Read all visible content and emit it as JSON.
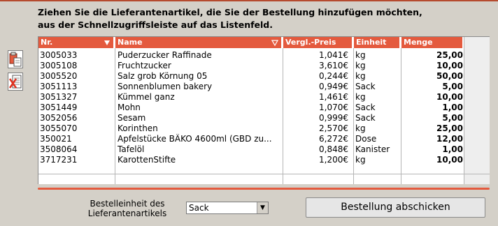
{
  "instruction": {
    "line1": "Ziehen Sie die Lieferantenartikel, die Sie der Bestellung hinzufügen möchten,",
    "line2": "aus der Schnellzugriffsleiste auf das Listenfeld."
  },
  "table": {
    "columns": [
      {
        "key": "nr",
        "label": "Nr."
      },
      {
        "key": "name",
        "label": "Name"
      },
      {
        "key": "preis",
        "label": "Vergl.-Preis"
      },
      {
        "key": "einheit",
        "label": "Einheit"
      },
      {
        "key": "menge",
        "label": "Menge"
      }
    ],
    "rows": [
      {
        "nr": "3005033",
        "name": "Puderzucker Raffinade",
        "preis": "1,041€",
        "einheit": "kg",
        "menge": "25,00"
      },
      {
        "nr": "3005108",
        "name": "Fruchtzucker",
        "preis": "3,610€",
        "einheit": "kg",
        "menge": "10,00"
      },
      {
        "nr": "3005520",
        "name": "Salz grob Körnung 05",
        "preis": "0,244€",
        "einheit": "kg",
        "menge": "50,00"
      },
      {
        "nr": "3051113",
        "name": "Sonnenblumen bakery",
        "preis": "0,949€",
        "einheit": "Sack",
        "menge": "5,00"
      },
      {
        "nr": "3051327",
        "name": "Kümmel ganz",
        "preis": "1,461€",
        "einheit": "kg",
        "menge": "10,00"
      },
      {
        "nr": "3051449",
        "name": "Mohn",
        "preis": "1,070€",
        "einheit": "Sack",
        "menge": "1,00"
      },
      {
        "nr": "3052056",
        "name": "Sesam",
        "preis": "0,999€",
        "einheit": "Sack",
        "menge": "5,00"
      },
      {
        "nr": "3055070",
        "name": "Korinthen",
        "preis": "2,570€",
        "einheit": "kg",
        "menge": "25,00"
      },
      {
        "nr": "350021",
        "name": "Apfelstücke BÄKO 4600ml (GBD zu...",
        "preis": "6,272€",
        "einheit": "Dose",
        "menge": "12,00"
      },
      {
        "nr": "3508064",
        "name": "Tafelöl",
        "preis": "0,848€",
        "einheit": "Kanister",
        "menge": "1,00"
      },
      {
        "nr": "3717231",
        "name": "KarottenStifte",
        "preis": "1,200€",
        "einheit": "kg",
        "menge": "10,00"
      }
    ]
  },
  "footer": {
    "unit_label_line1": "Bestelleinheit des",
    "unit_label_line2": "Lieferantenartikels",
    "unit_selected": "Sack",
    "submit_label": "Bestellung abschicken"
  },
  "colors": {
    "accent": "#e45a3e",
    "background": "#d4d0c8"
  },
  "icons": {
    "paste": "paste-icon",
    "delete": "delete-list-icon"
  }
}
